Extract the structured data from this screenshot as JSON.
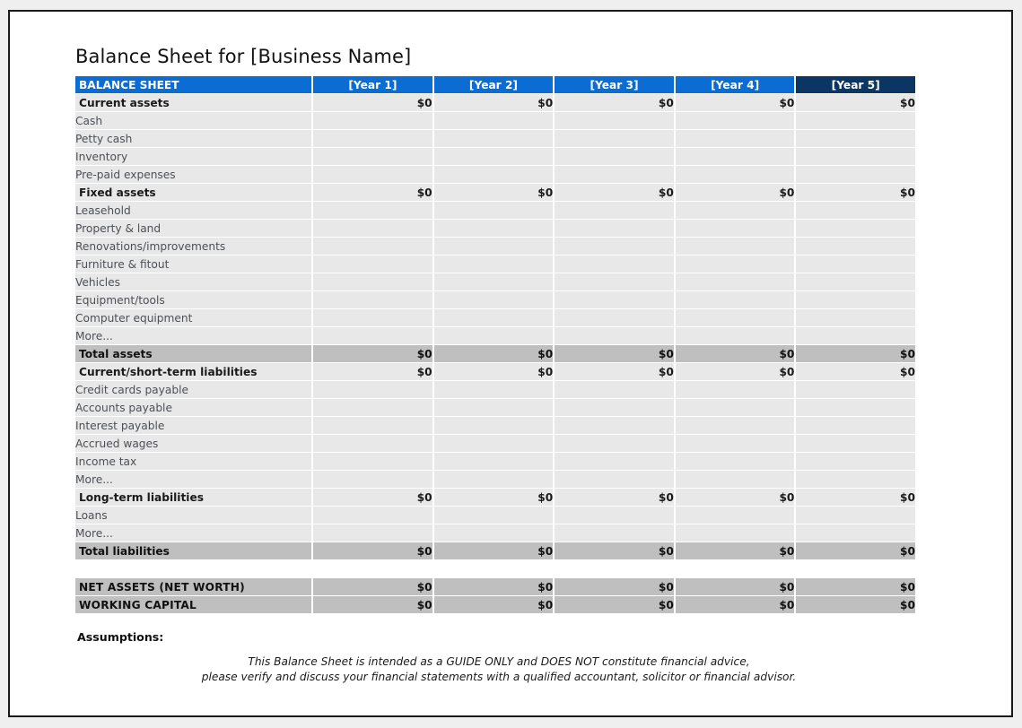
{
  "document": {
    "title": "Balance Sheet for [Business Name]",
    "assumptions_label": "Assumptions:",
    "disclaimer_line1": "This Balance Sheet is intended as a GUIDE ONLY and DOES NOT constitute financial advice,",
    "disclaimer_line2": "please verify and discuss your financial statements with a qualified accountant, solicitor or financial advisor."
  },
  "colors": {
    "header_blue": "#0b6cd4",
    "header_navy": "#0b3563",
    "row_gray": "#e8e8e8",
    "total_gray": "#bfbfbf",
    "page_border": "#1a1a1a"
  },
  "table": {
    "header": {
      "label": "BALANCE SHEET",
      "columns": [
        "[Year 1]",
        "[Year 2]",
        "[Year 3]",
        "[Year 4]",
        "[Year 5]"
      ]
    },
    "rows": [
      {
        "label": "Current assets",
        "type": "section",
        "values": [
          "$0",
          "$0",
          "$0",
          "$0",
          "$0"
        ]
      },
      {
        "label": "Cash",
        "type": "item",
        "values": [
          "",
          "",
          "",
          "",
          ""
        ]
      },
      {
        "label": "Petty cash",
        "type": "item",
        "values": [
          "",
          "",
          "",
          "",
          ""
        ]
      },
      {
        "label": "Inventory",
        "type": "item",
        "values": [
          "",
          "",
          "",
          "",
          ""
        ]
      },
      {
        "label": "Pre-paid expenses",
        "type": "item",
        "values": [
          "",
          "",
          "",
          "",
          ""
        ]
      },
      {
        "label": "Fixed assets",
        "type": "section",
        "values": [
          "$0",
          "$0",
          "$0",
          "$0",
          "$0"
        ]
      },
      {
        "label": "Leasehold",
        "type": "item",
        "values": [
          "",
          "",
          "",
          "",
          ""
        ]
      },
      {
        "label": "Property & land",
        "type": "item",
        "values": [
          "",
          "",
          "",
          "",
          ""
        ]
      },
      {
        "label": "Renovations/improvements",
        "type": "item",
        "values": [
          "",
          "",
          "",
          "",
          ""
        ]
      },
      {
        "label": "Furniture & fitout",
        "type": "item",
        "values": [
          "",
          "",
          "",
          "",
          ""
        ]
      },
      {
        "label": "Vehicles",
        "type": "item",
        "values": [
          "",
          "",
          "",
          "",
          ""
        ]
      },
      {
        "label": "Equipment/tools",
        "type": "item",
        "values": [
          "",
          "",
          "",
          "",
          ""
        ]
      },
      {
        "label": "Computer equipment",
        "type": "item",
        "values": [
          "",
          "",
          "",
          "",
          ""
        ]
      },
      {
        "label": "More...",
        "type": "item",
        "values": [
          "",
          "",
          "",
          "",
          ""
        ]
      },
      {
        "label": "Total assets",
        "type": "total",
        "values": [
          "$0",
          "$0",
          "$0",
          "$0",
          "$0"
        ]
      },
      {
        "label": "Current/short-term liabilities",
        "type": "section",
        "values": [
          "$0",
          "$0",
          "$0",
          "$0",
          "$0"
        ]
      },
      {
        "label": "Credit cards payable",
        "type": "item",
        "values": [
          "",
          "",
          "",
          "",
          ""
        ]
      },
      {
        "label": "Accounts payable",
        "type": "item",
        "values": [
          "",
          "",
          "",
          "",
          ""
        ]
      },
      {
        "label": "Interest payable",
        "type": "item",
        "values": [
          "",
          "",
          "",
          "",
          ""
        ]
      },
      {
        "label": "Accrued wages",
        "type": "item",
        "values": [
          "",
          "",
          "",
          "",
          ""
        ]
      },
      {
        "label": "Income tax",
        "type": "item",
        "values": [
          "",
          "",
          "",
          "",
          ""
        ]
      },
      {
        "label": "More...",
        "type": "item",
        "values": [
          "",
          "",
          "",
          "",
          ""
        ]
      },
      {
        "label": "Long-term liabilities",
        "type": "section",
        "values": [
          "$0",
          "$0",
          "$0",
          "$0",
          "$0"
        ]
      },
      {
        "label": "Loans",
        "type": "item",
        "values": [
          "",
          "",
          "",
          "",
          ""
        ]
      },
      {
        "label": "More...",
        "type": "item",
        "values": [
          "",
          "",
          "",
          "",
          ""
        ]
      },
      {
        "label": "Total liabilities",
        "type": "total",
        "values": [
          "$0",
          "$0",
          "$0",
          "$0",
          "$0"
        ]
      },
      {
        "label": "",
        "type": "spacer",
        "values": [
          "",
          "",
          "",
          "",
          ""
        ]
      },
      {
        "label": "NET ASSETS (NET WORTH)",
        "type": "summary",
        "values": [
          "$0",
          "$0",
          "$0",
          "$0",
          "$0"
        ]
      },
      {
        "label": "WORKING CAPITAL",
        "type": "summary",
        "values": [
          "$0",
          "$0",
          "$0",
          "$0",
          "$0"
        ]
      }
    ]
  }
}
